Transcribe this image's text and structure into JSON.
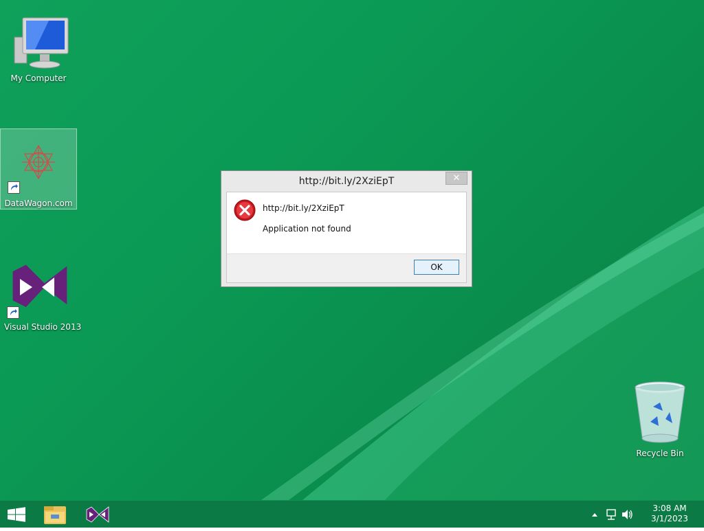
{
  "desktop": {
    "icons": [
      {
        "label": "My Computer",
        "icon": "computer-icon"
      },
      {
        "label": "DataWagon.com",
        "icon": "datawagon-shortcut-icon"
      },
      {
        "label": "Visual Studio 2013",
        "icon": "visual-studio-icon"
      },
      {
        "label": "Recycle Bin",
        "icon": "recycle-bin-icon"
      }
    ]
  },
  "dialog": {
    "title": "http://bit.ly/2XziEpT",
    "close_glyph": "✕",
    "url_line": "http://bit.ly/2XziEpT",
    "message": "Application not found",
    "ok_label": "OK",
    "icon": "error-icon"
  },
  "taskbar": {
    "items": [
      "start-button",
      "file-explorer-icon",
      "visual-studio-icon"
    ],
    "tray_icons": [
      "show-hidden-icons-chevron",
      "network-icon",
      "volume-icon"
    ],
    "time": "3:08 AM",
    "date": "3/1/2023"
  },
  "colors": {
    "desktop": "#0b9a55",
    "taskbar": "#0b7a45",
    "error": "#c4161c",
    "vs_purple": "#68217a"
  }
}
